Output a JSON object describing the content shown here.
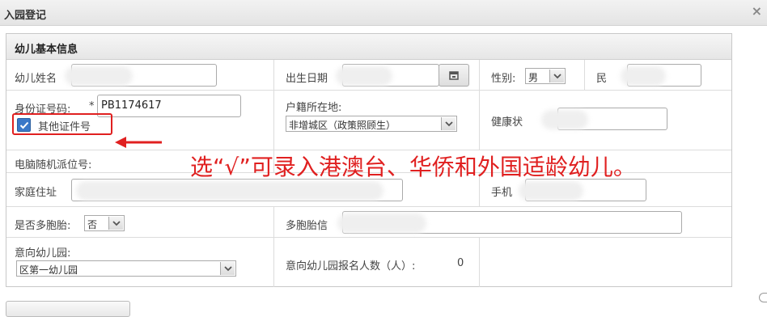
{
  "dialog": {
    "title": "入园登记",
    "close_glyph": "×"
  },
  "panel": {
    "header": "幼儿基本信息"
  },
  "fields": {
    "child_name_label": "幼儿姓名",
    "birth_date_label": "出生日期",
    "gender_label": "性别:",
    "gender_value": "男",
    "ethnicity_label": "民",
    "id_label": "身份证号码:",
    "id_required": "*",
    "id_value": "PB1174617",
    "other_id_label": "其他证件号",
    "household_label": "户籍所在地:",
    "household_value": "非增城区（政策照顾生）",
    "health_label": "健康状",
    "computer_no_label": "电脑随机派位号:",
    "address_label": "家庭住址",
    "phone_label": "手机",
    "multiple_birth_label": "是否多胞胎:",
    "multiple_birth_value": "否",
    "multiple_info_label": "多胞胎信",
    "kindergarten_label": "意向幼儿园:",
    "kindergarten_value": "区第一幼儿园",
    "apply_count_label": "意向幼儿园报名人数（人）:",
    "apply_count_value": "0"
  },
  "annotation": {
    "text": "选“√”可录入港澳台、华侨和外国适龄幼儿。",
    "color": "#e02020"
  }
}
